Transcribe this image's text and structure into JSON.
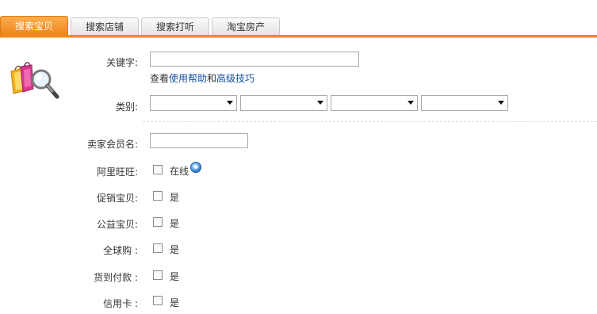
{
  "tabs": [
    {
      "label": "搜索宝贝",
      "active": true
    },
    {
      "label": "搜索店铺",
      "active": false
    },
    {
      "label": "搜索打听",
      "active": false
    },
    {
      "label": "淘宝房产",
      "active": false
    }
  ],
  "form": {
    "keyword_label": "关键字:",
    "keyword_value": "",
    "help_prefix": "查看",
    "help_link1": "使用帮助",
    "help_and": "和",
    "help_link2": "高级技巧",
    "category_label": "类别:",
    "category_selects": [
      "",
      "",
      "",
      ""
    ],
    "seller_label": "卖家会员名:",
    "seller_value": "",
    "wangwang_label": "阿里旺旺:",
    "wangwang_option": "在线",
    "promo_label": "促销宝贝:",
    "promo_option": "是",
    "charity_label": "公益宝贝:",
    "charity_option": "是",
    "global_label": "全球购 :",
    "global_option": "是",
    "cod_label": "货到付款 :",
    "cod_option": "是",
    "credit_label": "信用卡 :",
    "credit_option": "是"
  },
  "colors": {
    "accent": "#f08a1c",
    "link": "#1a4fa3"
  }
}
